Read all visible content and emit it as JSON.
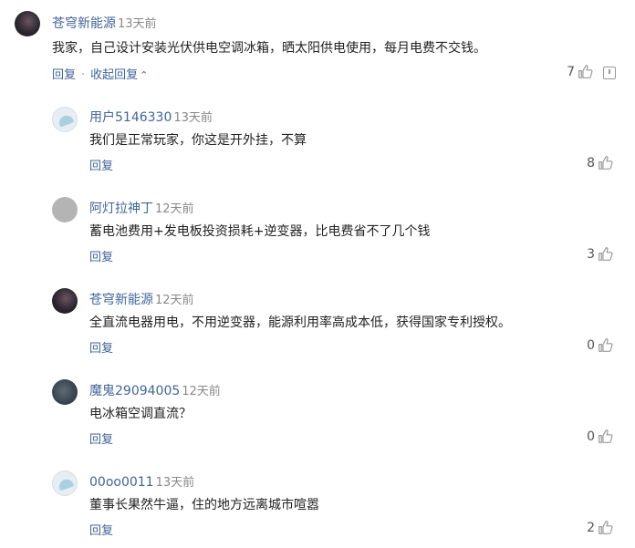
{
  "comments": [
    {
      "user": "苍穹新能源",
      "time": "13天前",
      "text": "我家，自己设计安装光伏供电空调冰箱，晒太阳供电使用，每月电费不交钱。",
      "reply": "回复",
      "collapse": "收起回复",
      "likes": "7",
      "avatar": "dark"
    },
    {
      "user": "用户5146330",
      "time": "13天前",
      "text": "我们是正常玩家，你这是开外挂，不算",
      "reply": "回复",
      "likes": "8",
      "avatar": "light"
    },
    {
      "user": "阿灯拉神丁",
      "time": "12天前",
      "text": "蓄电池费用+发电板投资损耗+逆变器，比电费省不了几个钱",
      "reply": "回复",
      "likes": "3",
      "avatar": "gray"
    },
    {
      "user": "苍穹新能源",
      "time": "12天前",
      "text": "全直流电器用电，不用逆变器，能源利用率高成本低，获得国家专利授权。",
      "reply": "回复",
      "likes": "0",
      "avatar": "dark"
    },
    {
      "user": "魔鬼29094005",
      "time": "12天前",
      "text": "电冰箱空调直流？",
      "reply": "回复",
      "likes": "0",
      "avatar": "photo"
    },
    {
      "user": "00oo0011",
      "time": "13天前",
      "text": "董事长果然牛逼，住的地方远离城市喧嚣",
      "reply": "回复",
      "likes": "2",
      "avatar": "light"
    }
  ]
}
